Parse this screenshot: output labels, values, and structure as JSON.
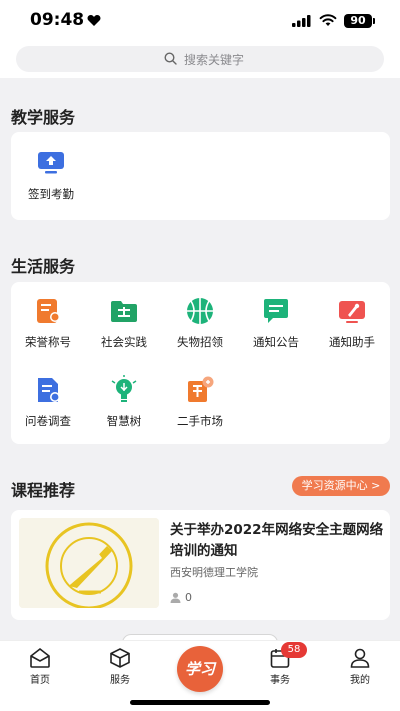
{
  "status": {
    "time": "09:48",
    "battery": "90"
  },
  "search": {
    "placeholder": "搜索关键字"
  },
  "teaching": {
    "title": "教学服务",
    "items": [
      {
        "label": "签到考勤",
        "icon": "attendance-icon"
      }
    ]
  },
  "life": {
    "title": "生活服务",
    "items": [
      {
        "label": "荣誉称号",
        "icon": "honor-icon",
        "color": "#f07a2e"
      },
      {
        "label": "社会实践",
        "icon": "folder-practice-icon",
        "color": "#21a366"
      },
      {
        "label": "失物招领",
        "icon": "basketball-icon",
        "color": "#1db37a"
      },
      {
        "label": "通知公告",
        "icon": "chat-notice-icon",
        "color": "#1db37a"
      },
      {
        "label": "通知助手",
        "icon": "notify-assistant-icon",
        "color": "#ef5350"
      },
      {
        "label": "问卷调查",
        "icon": "survey-icon",
        "color": "#3d6fe0"
      },
      {
        "label": "智慧树",
        "icon": "bulb-tree-icon",
        "color": "#1db37a"
      },
      {
        "label": "二手市场",
        "icon": "market-icon",
        "color": "#f07a2e"
      }
    ]
  },
  "courses": {
    "title": "课程推荐",
    "resource_button": "学习资源中心 >",
    "items": [
      {
        "title": "关于举办2022年网络安全主题网络培训的通知",
        "school": "西安明德理工学院",
        "views": "0"
      }
    ]
  },
  "tabbar": {
    "items": [
      {
        "label": "首页",
        "icon": "home-icon"
      },
      {
        "label": "服务",
        "icon": "cube-icon"
      },
      {
        "label": "学习",
        "icon": "study-icon"
      },
      {
        "label": "事务",
        "icon": "calendar-icon"
      },
      {
        "label": "我的",
        "icon": "person-icon"
      }
    ],
    "badge": "58"
  }
}
